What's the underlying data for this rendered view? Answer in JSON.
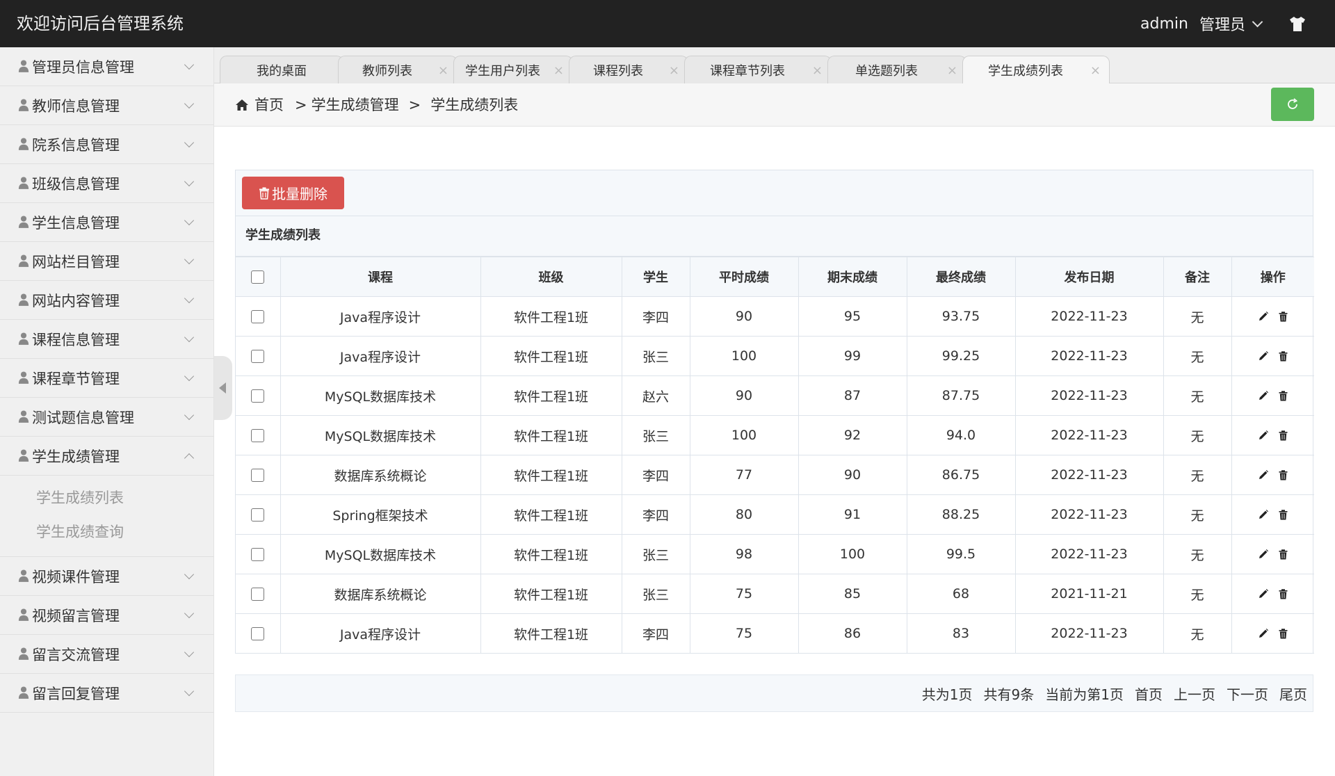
{
  "app": {
    "title": "欢迎访问后台管理系统",
    "username": "admin",
    "role": "管理员",
    "accent_green": "#5cb85c",
    "danger_red": "#d9534f"
  },
  "sidebar": {
    "items": [
      {
        "label": "管理员信息管理"
      },
      {
        "label": "教师信息管理"
      },
      {
        "label": "院系信息管理"
      },
      {
        "label": "班级信息管理"
      },
      {
        "label": "学生信息管理"
      },
      {
        "label": "网站栏目管理"
      },
      {
        "label": "网站内容管理"
      },
      {
        "label": "课程信息管理"
      },
      {
        "label": "课程章节管理"
      },
      {
        "label": "测试题信息管理"
      },
      {
        "label": "学生成绩管理"
      },
      {
        "label": "视频课件管理"
      },
      {
        "label": "视频留言管理"
      },
      {
        "label": "留言交流管理"
      },
      {
        "label": "留言回复管理"
      }
    ],
    "open_submenu": [
      "学生成绩列表",
      "学生成绩查询"
    ]
  },
  "tabs": [
    {
      "label": "我的桌面",
      "closable": false
    },
    {
      "label": "教师列表",
      "closable": true
    },
    {
      "label": "学生用户列表",
      "closable": true
    },
    {
      "label": "课程列表",
      "closable": true
    },
    {
      "label": "课程章节列表",
      "closable": true
    },
    {
      "label": "单选题列表",
      "closable": true
    },
    {
      "label": "学生成绩列表",
      "closable": true,
      "active": true
    }
  ],
  "breadcrumb": {
    "home": "首页",
    "sep": ">",
    "level1": "学生成绩管理",
    "level2": "学生成绩列表"
  },
  "toolbar": {
    "bulk_delete": "批量删除"
  },
  "table": {
    "title": "学生成绩列表",
    "columns": [
      "课程",
      "班级",
      "学生",
      "平时成绩",
      "期末成绩",
      "最终成绩",
      "发布日期",
      "备注",
      "操作"
    ],
    "rows": [
      [
        "Java程序设计",
        "软件工程1班",
        "李四",
        "90",
        "95",
        "93.75",
        "2022-11-23",
        "无"
      ],
      [
        "Java程序设计",
        "软件工程1班",
        "张三",
        "100",
        "99",
        "99.25",
        "2022-11-23",
        "无"
      ],
      [
        "MySQL数据库技术",
        "软件工程1班",
        "赵六",
        "90",
        "87",
        "87.75",
        "2022-11-23",
        "无"
      ],
      [
        "MySQL数据库技术",
        "软件工程1班",
        "张三",
        "100",
        "92",
        "94.0",
        "2022-11-23",
        "无"
      ],
      [
        "数据库系统概论",
        "软件工程1班",
        "李四",
        "77",
        "90",
        "86.75",
        "2022-11-23",
        "无"
      ],
      [
        "Spring框架技术",
        "软件工程1班",
        "李四",
        "80",
        "91",
        "88.25",
        "2022-11-23",
        "无"
      ],
      [
        "MySQL数据库技术",
        "软件工程1班",
        "张三",
        "98",
        "100",
        "99.5",
        "2022-11-23",
        "无"
      ],
      [
        "数据库系统概论",
        "软件工程1班",
        "张三",
        "75",
        "85",
        "68",
        "2021-11-21",
        "无"
      ],
      [
        "Java程序设计",
        "软件工程1班",
        "李四",
        "75",
        "86",
        "83",
        "2022-11-23",
        "无"
      ]
    ]
  },
  "pager": {
    "total_pages": "共为1页",
    "total_records": "共有9条",
    "current": "当前为第1页",
    "first": "首页",
    "prev": "上一页",
    "next": "下一页",
    "last": "尾页"
  }
}
